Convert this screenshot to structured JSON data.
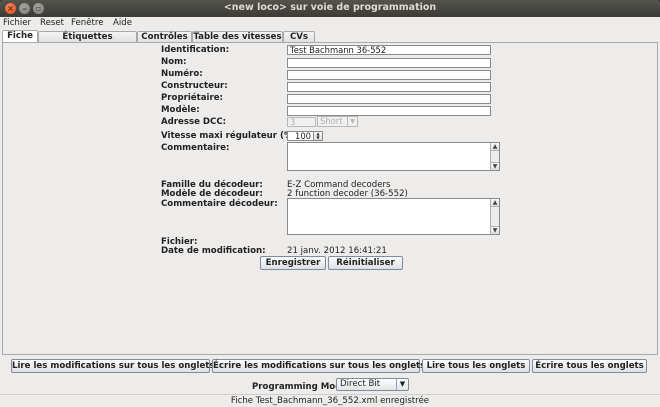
{
  "window": {
    "title": "<new loco> sur voie de programmation"
  },
  "menu": [
    "Fichier",
    "Reset",
    "Fenêtre",
    "Aide"
  ],
  "tabs": [
    "Fiche",
    "Étiquettes fonctions",
    "Contrôles",
    "Table des vitesses",
    "CVs"
  ],
  "active_tab": "Fiche",
  "form": {
    "identification_label": "Identification:",
    "identification_value": "Test Bachmann 36-552",
    "nom_label": "Nom:",
    "numero_label": "Numéro:",
    "constructeur_label": "Constructeur:",
    "proprietaire_label": "Propriétaire:",
    "modele_label": "Modèle:",
    "adresse_label": "Adresse DCC:",
    "adresse_value": "3",
    "adresse_mode": "Short",
    "vitesse_label": "Vitesse maxi régulateur (%):",
    "vitesse_value": "100",
    "commentaire_label": "Commentaire:",
    "famille_label": "Famille du décodeur:",
    "famille_value": "E-Z Command decoders",
    "modele_decodeur_label": "Modèle de décodeur:",
    "modele_decodeur_value": "2 function decoder (36-552)",
    "commentaire_decodeur_label": "Commentaire décodeur:",
    "fichier_label": "Fichier:",
    "date_label": "Date de modification:",
    "date_value": "21 janv. 2012 16:41:21"
  },
  "buttons": {
    "enregistrer": "Enregistrer",
    "reinitialiser": "Réinitialiser",
    "lire_modifs": "Lire les modifications sur tous les onglets",
    "ecrire_modifs": "Écrire les modifications sur tous les onglets",
    "lire_tous": "Lire tous les onglets",
    "ecrire_tous": "Écrire tous les onglets"
  },
  "programming": {
    "label": "Programming Mode",
    "value": "Direct Bit"
  },
  "status": "Fiche Test_Bachmann_36_552.xml enregistrée",
  "colors": {
    "titlebar": "#3c3b37",
    "close_button": "#df4a16",
    "window_bg": "#edeceb"
  }
}
